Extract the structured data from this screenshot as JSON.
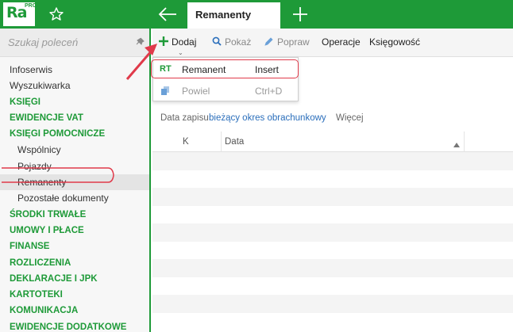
{
  "app": {
    "logo": "Ra",
    "logo_badge": "PRO",
    "active_tab": "Remanenty"
  },
  "sidebar": {
    "search_placeholder": "Szukaj poleceń",
    "items": [
      {
        "label": "Infoserwis",
        "type": "link"
      },
      {
        "label": "Wyszukiwarka",
        "type": "link"
      },
      {
        "label": "KSIĘGI",
        "type": "head"
      },
      {
        "label": "EWIDENCJE VAT",
        "type": "head"
      },
      {
        "label": "KSIĘGI POMOCNICZE",
        "type": "head"
      },
      {
        "label": "Wspólnicy",
        "type": "sub"
      },
      {
        "label": "Pojazdy",
        "type": "sub"
      },
      {
        "label": "Remanenty",
        "type": "sub",
        "selected": true
      },
      {
        "label": "Pozostałe dokumenty",
        "type": "sub"
      },
      {
        "label": "ŚRODKI TRWAŁE",
        "type": "head"
      },
      {
        "label": "UMOWY I PŁACE",
        "type": "head"
      },
      {
        "label": "FINANSE",
        "type": "head"
      },
      {
        "label": "ROZLICZENIA",
        "type": "head"
      },
      {
        "label": "DEKLARACJE I JPK",
        "type": "head"
      },
      {
        "label": "KARTOTEKI",
        "type": "head"
      },
      {
        "label": "KOMUNIKACJA",
        "type": "head"
      },
      {
        "label": "EWIDENCJE DODATKOWE",
        "type": "head"
      }
    ]
  },
  "toolbar": {
    "add_label": "Dodaj",
    "show_label": "Pokaż",
    "edit_label": "Popraw",
    "operations_label": "Operacje",
    "accounting_label": "Księgowość"
  },
  "dropdown": {
    "items": [
      {
        "code": "RT",
        "label": "Remanent",
        "shortcut": "Insert",
        "enabled": true
      },
      {
        "code": "",
        "label": "Powiel",
        "shortcut": "Ctrl+D",
        "enabled": false
      }
    ]
  },
  "filter": {
    "label": "Data zapisu",
    "value": "bieżący okres obrachunkowy",
    "more": "Więcej"
  },
  "table": {
    "columns": [
      "K",
      "Data"
    ],
    "row_count": 10
  },
  "colors": {
    "brand": "#1e9a38",
    "link": "#2a6ebb",
    "annotation": "#e03a4a"
  },
  "icons": [
    "star-icon",
    "back-arrow-icon",
    "plus-icon",
    "pin-icon",
    "add-icon",
    "search-icon",
    "pencil-icon",
    "copy-icon",
    "sort-up-icon"
  ]
}
